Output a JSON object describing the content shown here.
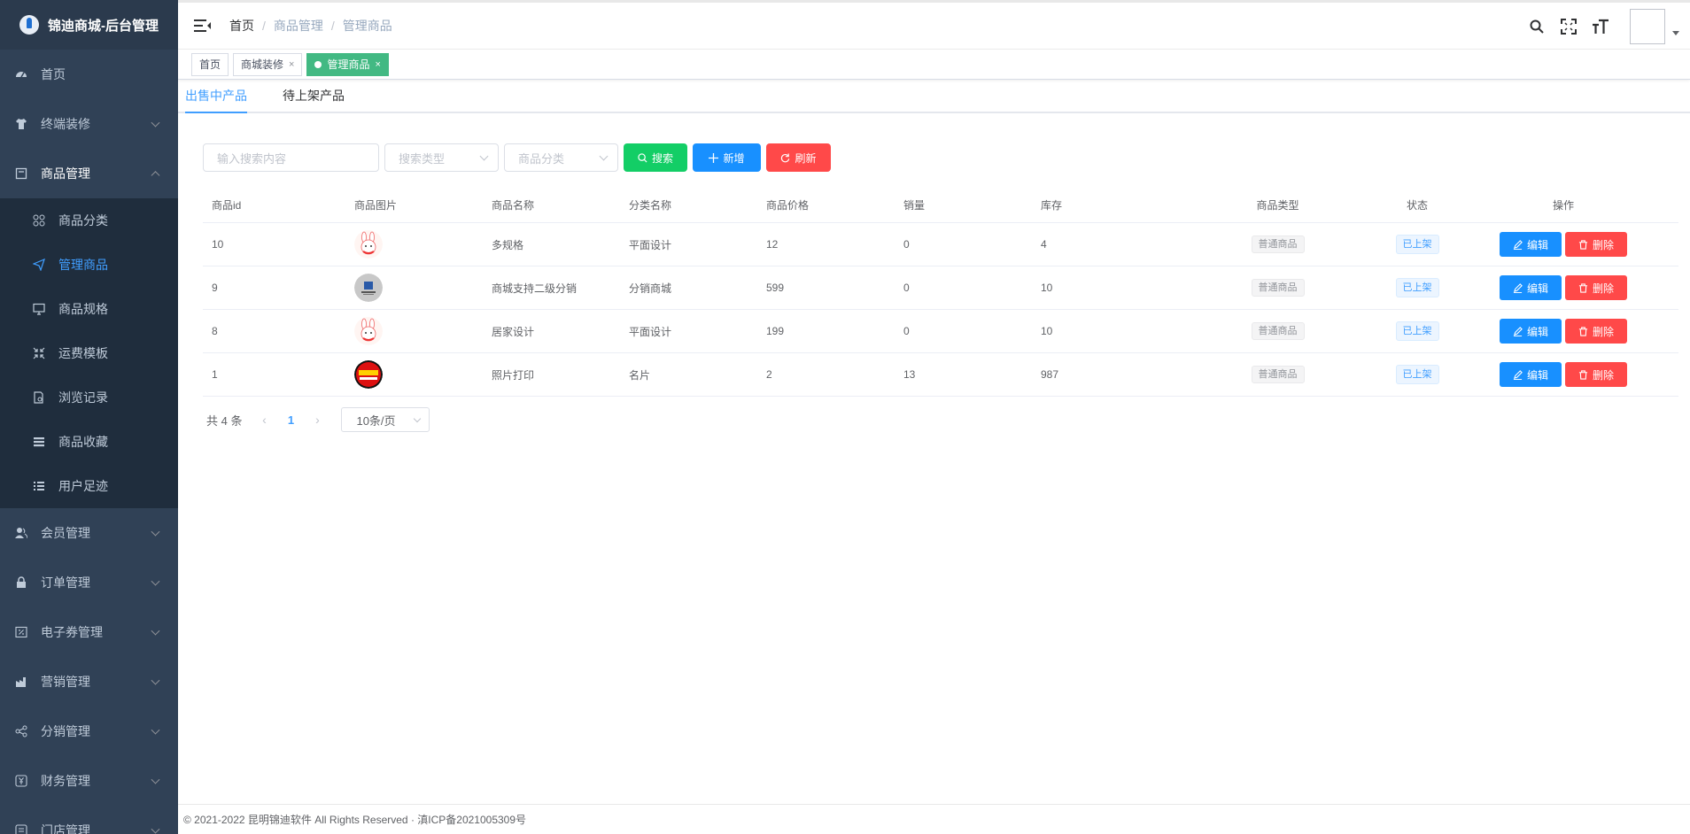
{
  "brand": {
    "title": "锦迪商城-后台管理"
  },
  "sidebar": {
    "items": [
      {
        "label": "首页",
        "icon": "dashboard-icon"
      },
      {
        "label": "终端装修",
        "icon": "shirt-icon"
      },
      {
        "label": "商品管理",
        "icon": "goods-icon"
      },
      {
        "label": "商品分类",
        "icon": "grid-icon"
      },
      {
        "label": "管理商品",
        "icon": "send-icon"
      },
      {
        "label": "商品规格",
        "icon": "monitor-icon"
      },
      {
        "label": "运费模板",
        "icon": "shrink-icon"
      },
      {
        "label": "浏览记录",
        "icon": "document-search-icon"
      },
      {
        "label": "商品收藏",
        "icon": "stack-icon"
      },
      {
        "label": "用户足迹",
        "icon": "list-icon"
      },
      {
        "label": "会员管理",
        "icon": "users-icon"
      },
      {
        "label": "订单管理",
        "icon": "lock-icon"
      },
      {
        "label": "电子券管理",
        "icon": "coupon-icon"
      },
      {
        "label": "营销管理",
        "icon": "factory-icon"
      },
      {
        "label": "分销管理",
        "icon": "share-icon"
      },
      {
        "label": "财务管理",
        "icon": "money-icon"
      },
      {
        "label": "门店管理",
        "icon": "store-icon"
      }
    ]
  },
  "header": {
    "breadcrumb": [
      "首页",
      "商品管理",
      "管理商品"
    ]
  },
  "tags": [
    {
      "label": "首页"
    },
    {
      "label": "商城装修"
    },
    {
      "label": "管理商品"
    }
  ],
  "tabs": [
    {
      "label": "出售中产品"
    },
    {
      "label": "待上架产品"
    }
  ],
  "toolbar": {
    "search_placeholder": "输入搜索内容",
    "type_placeholder": "搜索类型",
    "category_placeholder": "商品分类",
    "search_label": "搜索",
    "add_label": "新增",
    "refresh_label": "刷新"
  },
  "table": {
    "columns": [
      "商品id",
      "商品图片",
      "商品名称",
      "分类名称",
      "商品价格",
      "销量",
      "库存",
      "商品类型",
      "状态",
      "操作"
    ],
    "rows": [
      {
        "id": "10",
        "name": "多规格",
        "category": "平面设计",
        "price": "12",
        "sales": "0",
        "stock": "4",
        "type": "普通商品",
        "status": "已上架",
        "img": "rabbit"
      },
      {
        "id": "9",
        "name": "商城支持二级分销",
        "category": "分销商城",
        "price": "599",
        "sales": "0",
        "stock": "10",
        "type": "普通商品",
        "status": "已上架",
        "img": "logo"
      },
      {
        "id": "8",
        "name": "居家设计",
        "category": "平面设计",
        "price": "199",
        "sales": "0",
        "stock": "10",
        "type": "普通商品",
        "status": "已上架",
        "img": "rabbit"
      },
      {
        "id": "1",
        "name": "照片打印",
        "category": "名片",
        "price": "2",
        "sales": "13",
        "stock": "987",
        "type": "普通商品",
        "status": "已上架",
        "img": "print"
      }
    ],
    "edit_label": "编辑",
    "delete_label": "删除"
  },
  "pagination": {
    "total": "共 4 条",
    "current": "1",
    "page_size": "10条/页"
  },
  "footer": {
    "text": "© 2021-2022 昆明锦迪软件 All Rights Reserved · 滇ICP备2021005309号"
  }
}
